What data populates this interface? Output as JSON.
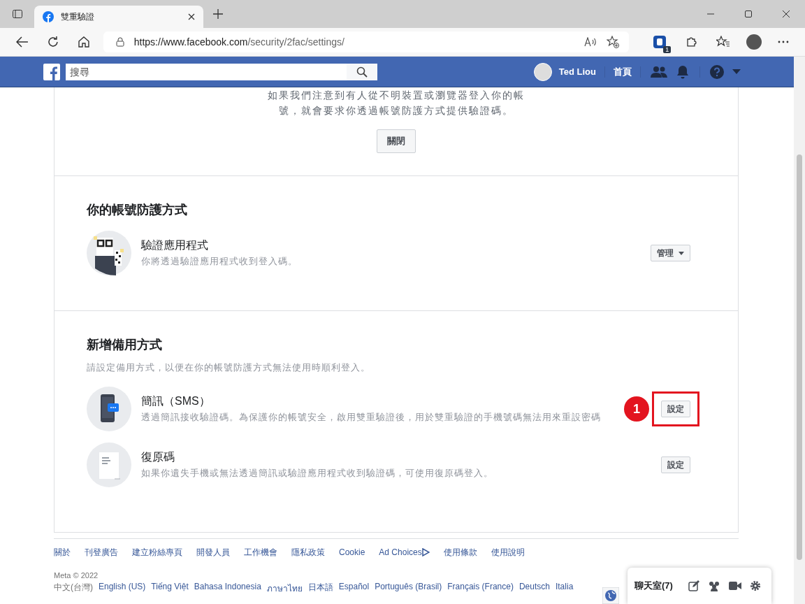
{
  "browser": {
    "tab_title": "雙重驗證",
    "url_host": "https://www.facebook.com",
    "url_path": "/security/2fac/settings/",
    "extension_badge": "1"
  },
  "topbar": {
    "search_placeholder": "搜尋",
    "user_name": "Ted Liou",
    "home_link": "首頁"
  },
  "intro": {
    "text": "如果我們注意到有人從不明裝置或瀏覽器登入你的帳號，就會要求你透過帳號防護方式提供驗證碼。",
    "button": "關閉"
  },
  "protection": {
    "title": "你的帳號防護方式",
    "methods": [
      {
        "kind": "app",
        "title": "驗證應用程式",
        "desc": "你將透過驗證應用程式收到登入碼。",
        "action": "管理",
        "has_caret": true,
        "highlighted": false
      }
    ]
  },
  "backup": {
    "title": "新增備用方式",
    "desc": "請設定備用方式，以便在你的帳號防護方式無法使用時順利登入。",
    "methods": [
      {
        "kind": "sms",
        "title": "簡訊（SMS）",
        "desc": "透過簡訊接收驗證碼。為保護你的帳號安全，啟用雙重驗證後，用於雙重驗證的手機號碼無法用來重設密碼",
        "action": "設定",
        "has_caret": false,
        "highlighted": true,
        "step": "1"
      },
      {
        "kind": "codes",
        "title": "復原碼",
        "desc": "如果你遺失手機或無法透過簡訊或驗證應用程式收到驗證碼，可使用復原碼登入。",
        "action": "設定",
        "has_caret": false,
        "highlighted": false
      }
    ]
  },
  "footer": {
    "links": [
      "關於",
      "刊登廣告",
      "建立粉絲專頁",
      "開發人員",
      "工作機會",
      "隱私政策",
      "Cookie",
      "Ad Choices",
      "使用條款",
      "使用說明"
    ],
    "copyright": "Meta © 2022",
    "languages": [
      {
        "label": "中文(台灣)",
        "selected": true
      },
      {
        "label": "English (US)",
        "selected": false
      },
      {
        "label": "Tiếng Việt",
        "selected": false
      },
      {
        "label": "Bahasa Indonesia",
        "selected": false
      },
      {
        "label": "ภาษาไทย",
        "selected": false
      },
      {
        "label": "日本語",
        "selected": false
      },
      {
        "label": "Español",
        "selected": false
      },
      {
        "label": "Português (Brasil)",
        "selected": false
      },
      {
        "label": "Français (France)",
        "selected": false
      },
      {
        "label": "Deutsch",
        "selected": false
      },
      {
        "label": "Italia",
        "selected": false
      }
    ]
  },
  "chat": {
    "label": "聊天室(7)"
  }
}
